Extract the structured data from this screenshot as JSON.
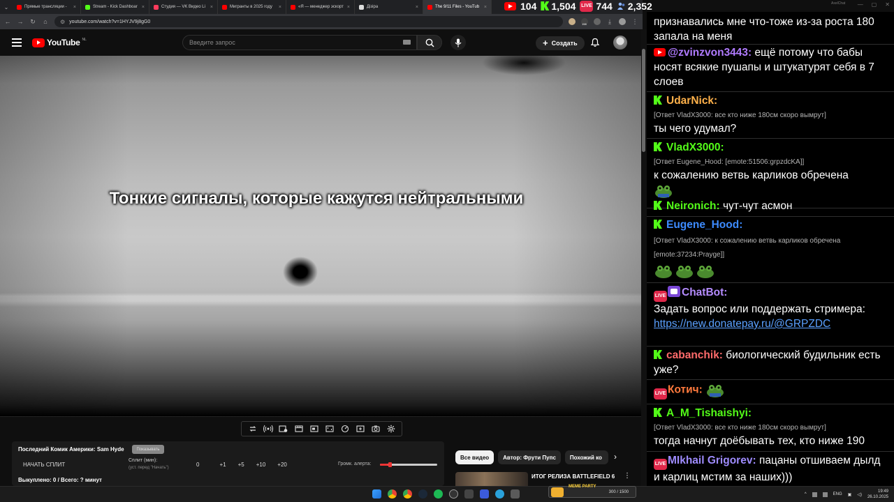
{
  "browser": {
    "tabs": [
      {
        "label": "Прямые трансляции -",
        "color": "#ff0000"
      },
      {
        "label": "Stream - Kick Dashboar",
        "color": "#53fc18"
      },
      {
        "label": "Студия — VK Видео Li",
        "color": "#ff3b5c"
      },
      {
        "label": "Мигранты в 2025 году",
        "color": "#ff0000"
      },
      {
        "label": "«Я — менеджер эскорт",
        "color": "#ff0000"
      },
      {
        "label": "Дiзiра",
        "color": "#dddddd"
      },
      {
        "label": "The 9/11 Files - YouTub",
        "color": "#ff0000"
      }
    ],
    "active_tab_index": 6,
    "url": "youtube.com/watch?v=1HYJV9j8gG0",
    "extension_badge": "198"
  },
  "youtube": {
    "logo_text": "YouTube",
    "region": "NL",
    "search_placeholder": "Введите запрос",
    "create_label": "Создать"
  },
  "video": {
    "subtitle": "Тонкие сигналы, которые кажутся нейтральными"
  },
  "panel": {
    "title": "Последний Комик Америки: Sam Hyde",
    "pill_label": "Показывать",
    "start_label": "НАЧАТЬ СПЛИТ",
    "split_label": "Сплит (мин):",
    "split_hint": "(уст. перед \"Начать\")",
    "split_value": "0",
    "increments": [
      "+1",
      "+5",
      "+10",
      "+20"
    ],
    "volume_label": "Громк. алерта:",
    "volume_level": 0.15,
    "total": "Выкуплено: 0 / Всего: ? минут"
  },
  "chips": [
    "Все видео",
    "Автор: Фрути Пупс",
    "Похожий ко"
  ],
  "recommendation": {
    "title": "ИТОГ РЕЛИЗА BATTLEFIELD 6"
  },
  "stats": [
    {
      "value": "104",
      "platform": "youtube",
      "color": "#ff0000"
    },
    {
      "value": "1,504",
      "platform": "kick",
      "color": "#53fc18"
    },
    {
      "value": "744",
      "platform": "vk-live",
      "color": "#e0284a"
    },
    {
      "value": "2,352",
      "platform": "total",
      "color": "#8fb7ff"
    }
  ],
  "chat_title": "AxelChat",
  "chat": {
    "messages": [
      {
        "platform": "none",
        "user": "",
        "color": "#ffffff",
        "reply": "",
        "text": "признавались мне что-тоже из-за роста 180 запала на меня"
      },
      {
        "platform": "youtube",
        "user": "@zvinzvon3443:",
        "color": "#b07bff",
        "reply": "",
        "text": "ещё потому что бабы носят всякие пушапы и штукатурят себя в 7 слоев"
      },
      {
        "platform": "kick",
        "user": "UdarNick:",
        "color": "#ffb14a",
        "reply": "[Ответ VladX3000: все кто ниже 180см скоро вымрут]",
        "text": "ты чего удумал?"
      },
      {
        "platform": "kick",
        "user": "VladX3000:",
        "color": "#53fc18",
        "reply": "[Ответ Eugene_Hood: [emote:51506:grpzdcKA]]",
        "text": "к сожалению ветвь карликов обречена",
        "emotes": 1
      },
      {
        "platform": "kick",
        "user": "Neironich:",
        "color": "#53fc18",
        "reply": "",
        "text": "чут-чут асмон"
      },
      {
        "platform": "kick",
        "user": "Eugene_Hood:",
        "color": "#3d8bff",
        "reply": "[Ответ VladX3000: к сожалению ветвь карликов обречена [emote:37234:Prayge]]",
        "text": "",
        "emotes": 3
      },
      {
        "platform": "vk-bot",
        "user": "ChatBot:",
        "color": "#b58cff",
        "reply": "",
        "text": "Задать вопрос или поддержать стримера:",
        "link": "https://new.donatepay.ru/@GRPZDC"
      },
      {
        "platform": "kick",
        "user": "cabanchik:",
        "color": "#ff6b6b",
        "reply": "",
        "text": "биологический будильник есть уже?"
      },
      {
        "platform": "vk-live",
        "user": "Котич:",
        "color": "#ff7a3d",
        "reply": "",
        "text": "",
        "emotes": 1
      },
      {
        "platform": "kick",
        "user": "A_M_Tishaishyi:",
        "color": "#53fc18",
        "reply": "[Ответ VladX3000: все кто ниже 180см скоро вымрут]",
        "text": "тогда начнут доёбывать тех, кто ниже 190"
      },
      {
        "platform": "vk-live",
        "user": "MIkhail Grigorev:",
        "color": "#9f8cff",
        "reply": "",
        "text": "пацаны отшиваем дылд и карлиц мстим за наших)))"
      }
    ]
  },
  "taskbar": {
    "lang": "ENG",
    "time": "19:49",
    "date": "26.10.2025",
    "meme_label": "MEME PARTY",
    "meme_count": "300 / 1500"
  }
}
